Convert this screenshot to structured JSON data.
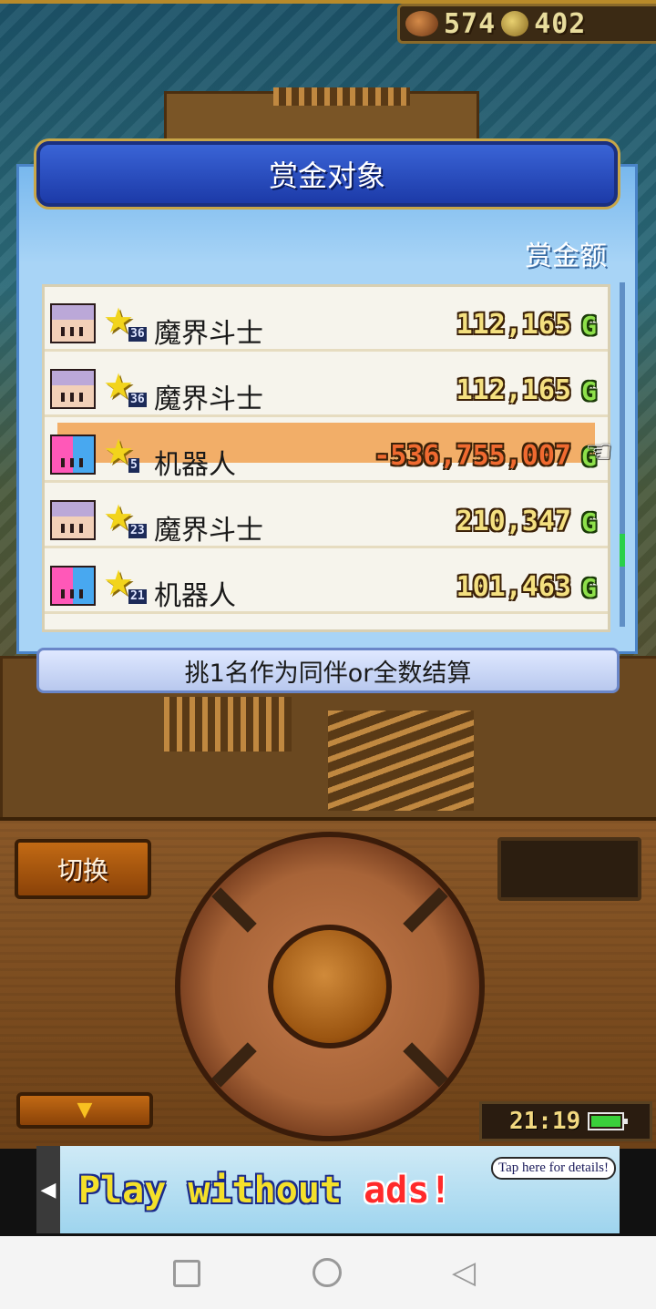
{
  "resources": {
    "wood_icon": "wood-log-icon",
    "wood_count": "574",
    "gold_icon": "gold-coin-icon",
    "gold_count": "402"
  },
  "panel": {
    "title": "赏金对象",
    "column_header": "赏金额",
    "currency_suffix": "G",
    "rows": [
      {
        "portrait": "demon-fighter-portrait",
        "level": "36",
        "name": "魔界斗士",
        "amount": "112,165",
        "selected": false
      },
      {
        "portrait": "demon-fighter-portrait",
        "level": "36",
        "name": "魔界斗士",
        "amount": "112,165",
        "selected": false
      },
      {
        "portrait": "robot-portrait",
        "level": "5",
        "name": "机器人",
        "amount": "-536,755,007",
        "selected": true
      },
      {
        "portrait": "demon-fighter-portrait",
        "level": "23",
        "name": "魔界斗士",
        "amount": "210,347",
        "selected": false
      },
      {
        "portrait": "robot-portrait",
        "level": "21",
        "name": "机器人",
        "amount": "101,463",
        "selected": false
      }
    ],
    "instruction": "挑1名作为同伴or全数结算"
  },
  "controls": {
    "switch_label": "切换",
    "down_arrow": "▼",
    "clock_time": "21:19",
    "battery_icon": "battery-full-icon"
  },
  "ad": {
    "text_main": "Play without ",
    "text_highlight": "ads!",
    "tap_label": "Tap here for details!"
  },
  "navbar": {
    "back_glyph": "◁"
  },
  "colors": {
    "panel_bg": "#a8d4f6",
    "title_bg": "#2a4ec0",
    "highlight_row": "#f2ae68",
    "amount_text": "#f4e080",
    "negative_amount": "#f06a30",
    "gold_mark": "#8ee04a"
  }
}
